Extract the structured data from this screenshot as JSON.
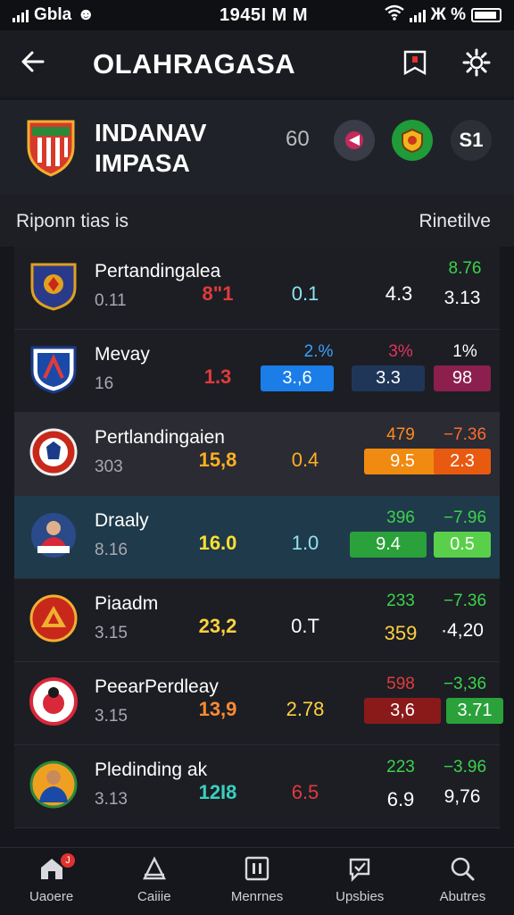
{
  "status_bar": {
    "carrier": "Gbla",
    "time": "1945I M M",
    "right_text": "Ж %"
  },
  "header": {
    "title": "OLAHRAGASA"
  },
  "team": {
    "name_line1": "INDANAV",
    "name_line2": "IMPASA",
    "score": "60",
    "badge_right": "S1"
  },
  "section": {
    "title": "Riponn tias is",
    "right_label": "Rinetilve"
  },
  "rows": [
    {
      "name": "Pertandingalea",
      "sub": "0.11",
      "v1": "8\"1",
      "v2": "0.1",
      "v3": "4.3",
      "top_a": "",
      "top_b": "8.76",
      "bot_b": "3.13",
      "v1_color": "#e23b3b",
      "v2_color": "#8fe3f0",
      "v3_color": "#ffffff",
      "top_b_color": "#3bd34a"
    },
    {
      "name": "Mevay",
      "sub": "16",
      "v1": "1.3",
      "v2": "",
      "v3": "",
      "top_a": "2.%",
      "top_b": "1%",
      "p1": "3.,6",
      "p2": "3.3",
      "p3": "98",
      "v1_color": "#e23b3b",
      "top_a_color": "#3aa0ff",
      "top_a2": "3%",
      "top_a2_color": "#e0355f",
      "p1_bg": "#1a7de8",
      "p2_bg": "#1f3658",
      "p3_bg": "#8c1f4e"
    },
    {
      "name": "Pertlandingaien",
      "sub": "303",
      "v1": "15,8",
      "v2": "0.4",
      "top_a": "479",
      "top_b": "−7.36",
      "p2": "9.5",
      "p3": "2.3",
      "v1_color": "#ffb020",
      "v2_color": "#ffb020",
      "top_a_color": "#ff8a20",
      "top_b_color": "#ff6a30",
      "p2_bg": "#f08a10",
      "p3_bg": "#e85a10"
    },
    {
      "name": "Draaly",
      "sub": "8.16",
      "v1": "16.0",
      "v2": "1.0",
      "top_a": "396",
      "top_b": "−7.96",
      "p2": "9.4",
      "p3": "0.5",
      "v1_color": "#ffe030",
      "v2_color": "#8fe3f0",
      "top_a_color": "#3bd34a",
      "top_b_color": "#3bd34a",
      "p2_bg": "#2aa13a",
      "p3_bg": "#5ad04a"
    },
    {
      "name": "Piaadm",
      "sub": "3.15",
      "v1": "23,2",
      "v2": "0.T",
      "top_a": "233",
      "top_b": "−7.36",
      "v3": "359",
      "bot_b": "·4,20",
      "v1_color": "#ffd040",
      "v2_color": "#ffffff",
      "v3_color": "#ffd040",
      "top_a_color": "#3bd34a",
      "top_b_color": "#3bd34a"
    },
    {
      "name": "PeearPerdleay",
      "sub": "3.15",
      "v1": "13,9",
      "v2": "2.78",
      "top_a": "598",
      "top_b": "−3,36",
      "p2": "3,6",
      "p3": "3.71",
      "v1_color": "#ff8a30",
      "v2_color": "#ffd040",
      "top_a_color": "#e23b3b",
      "top_b_color": "#3bd34a",
      "p2_bg": "#8a1a1a",
      "p3_bg": "#2aa13a"
    },
    {
      "name": "Pledinding ak",
      "sub": "3.13",
      "v1": "12I8",
      "v2": "6.5",
      "top_a": "223",
      "top_b": "−3.96",
      "v3": "6.9",
      "bot_b": "9,76",
      "v1_color": "#3ad0c0",
      "v2_color": "#e23b3b",
      "v3_color": "#ffffff",
      "top_a_color": "#3bd34a",
      "top_b_color": "#3bd34a"
    }
  ],
  "nav": [
    {
      "label": "Uaoere",
      "icon": "home-icon",
      "badge": "J"
    },
    {
      "label": "Caiiie",
      "icon": "tent-icon"
    },
    {
      "label": "Menrnes",
      "icon": "pause-box-icon"
    },
    {
      "label": "Upsbies",
      "icon": "chat-icon"
    },
    {
      "label": "Abutres",
      "icon": "search-icon"
    }
  ]
}
